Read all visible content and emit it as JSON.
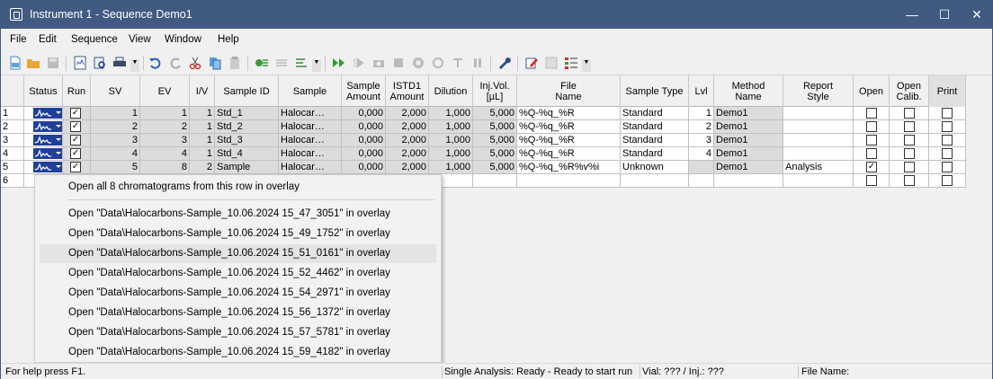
{
  "window": {
    "title": "Instrument 1 - Sequence Demo1",
    "minimize": "—",
    "maximize": "☐",
    "close": "✕"
  },
  "menu": [
    "File",
    "Edit",
    "Sequence",
    "View",
    "Window",
    "Help"
  ],
  "toolbar_icons": [
    "new-icon",
    "open-folder-icon",
    "save-icon",
    "print-preview-icon",
    "find-icon",
    "print-icon",
    "undo-icon",
    "redo-icon",
    "cut-icon",
    "copy-icon",
    "paste-icon",
    "insert-row-icon",
    "delete-row-icon",
    "fill-down-icon",
    "run-icon",
    "resume-icon",
    "snapshot-icon",
    "stop-icon",
    "pause-after-icon",
    "abort-icon",
    "pause-icon",
    "wrench-icon",
    "edit-icon",
    "disabled-edit-icon",
    "list-icon"
  ],
  "columns": [
    {
      "label": "Status"
    },
    {
      "label": "Run"
    },
    {
      "label": "SV"
    },
    {
      "label": "EV"
    },
    {
      "label": "I/V"
    },
    {
      "label": "Sample ID"
    },
    {
      "label": "Sample"
    },
    {
      "label": "Sample\nAmount"
    },
    {
      "label": "ISTD1\nAmount"
    },
    {
      "label": "Dilution"
    },
    {
      "label": "Inj.Vol.\n[µL]"
    },
    {
      "label": "File\nName"
    },
    {
      "label": "Sample Type"
    },
    {
      "label": "Lvl"
    },
    {
      "label": "Method\nName"
    },
    {
      "label": "Report\nStyle"
    },
    {
      "label": "Open"
    },
    {
      "label": "Open\nCalib."
    },
    {
      "label": "Print"
    }
  ],
  "rows": [
    {
      "n": "1",
      "sv": "1",
      "ev": "1",
      "iv": "1",
      "sid": "Std_1",
      "sample": "Halocar…",
      "samt": "0,000",
      "istd": "2,000",
      "dil": "1,000",
      "inj": "5,000",
      "file": "%Q-%q_%R",
      "type": "Standard",
      "lvl": "1",
      "method": "Demo1",
      "report": "",
      "open": false,
      "run": true
    },
    {
      "n": "2",
      "sv": "2",
      "ev": "2",
      "iv": "1",
      "sid": "Std_2",
      "sample": "Halocar…",
      "samt": "0,000",
      "istd": "2,000",
      "dil": "1,000",
      "inj": "5,000",
      "file": "%Q-%q_%R",
      "type": "Standard",
      "lvl": "2",
      "method": "Demo1",
      "report": "",
      "open": false,
      "run": true
    },
    {
      "n": "3",
      "sv": "3",
      "ev": "3",
      "iv": "1",
      "sid": "Std_3",
      "sample": "Halocar…",
      "samt": "0,000",
      "istd": "2,000",
      "dil": "1,000",
      "inj": "5,000",
      "file": "%Q-%q_%R",
      "type": "Standard",
      "lvl": "3",
      "method": "Demo1",
      "report": "",
      "open": false,
      "run": true
    },
    {
      "n": "4",
      "sv": "4",
      "ev": "4",
      "iv": "1",
      "sid": "Std_4",
      "sample": "Halocar…",
      "samt": "0,000",
      "istd": "2,000",
      "dil": "1,000",
      "inj": "5,000",
      "file": "%Q-%q_%R",
      "type": "Standard",
      "lvl": "4",
      "method": "Demo1",
      "report": "",
      "open": false,
      "run": true
    },
    {
      "n": "5",
      "sv": "5",
      "ev": "8",
      "iv": "2",
      "sid": "Sample",
      "sample": "Halocar…",
      "samt": "0,000",
      "istd": "2,000",
      "dil": "1,000",
      "inj": "5,000",
      "file": "%Q-%q_%R%v%i",
      "type": "Unknown",
      "lvl": "",
      "method": "Demo1",
      "report": "Analysis",
      "open": true,
      "run": true
    },
    {
      "n": "6"
    }
  ],
  "context_menu": {
    "first": "Open all 8 chromatograms from this row in overlay",
    "items": [
      "Open \"Data\\Halocarbons-Sample_10.06.2024 15_47_3051\" in overlay",
      "Open \"Data\\Halocarbons-Sample_10.06.2024 15_49_1752\" in overlay",
      "Open \"Data\\Halocarbons-Sample_10.06.2024 15_51_0161\" in overlay",
      "Open \"Data\\Halocarbons-Sample_10.06.2024 15_52_4462\" in overlay",
      "Open \"Data\\Halocarbons-Sample_10.06.2024 15_54_2971\" in overlay",
      "Open \"Data\\Halocarbons-Sample_10.06.2024 15_56_1372\" in overlay",
      "Open \"Data\\Halocarbons-Sample_10.06.2024 15_57_5781\" in overlay",
      "Open \"Data\\Halocarbons-Sample_10.06.2024 15_59_4182\" in overlay"
    ],
    "highlighted_index": 2
  },
  "statusbar": {
    "help": "For help press F1.",
    "analysis": "Single Analysis: Ready - Ready to start run",
    "vial": "Vial: ??? / Inj.: ???",
    "file": "File Name:"
  },
  "colors": {
    "titlebar": "#405a82",
    "status_cell": "#1f3f9a"
  }
}
